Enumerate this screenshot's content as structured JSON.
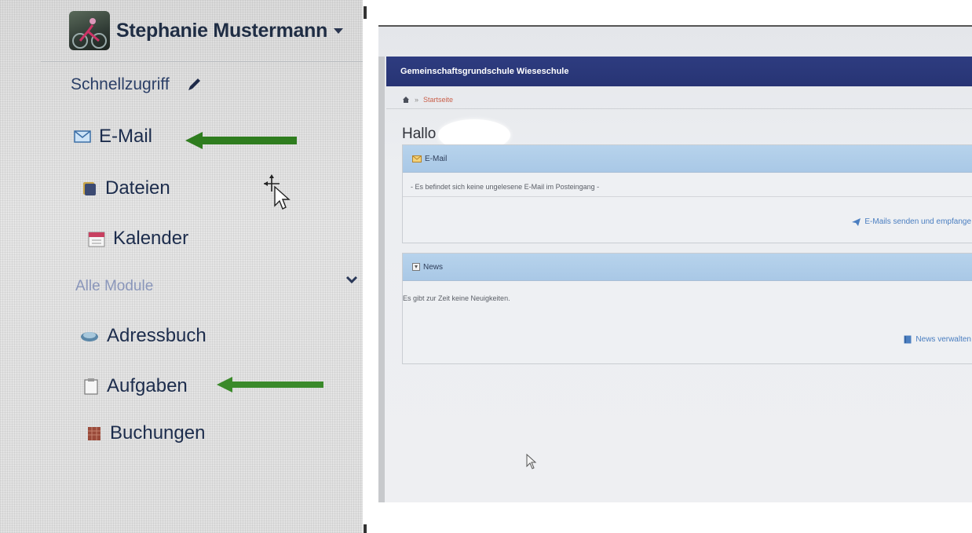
{
  "left": {
    "user": {
      "name": "Stephanie Mustermann"
    },
    "quick_access": {
      "label": "Schnellzugriff"
    },
    "nav": [
      {
        "label": "E-Mail",
        "icon": "envelope-icon"
      },
      {
        "label": "Dateien",
        "icon": "folder-icon"
      },
      {
        "label": "Kalender",
        "icon": "calendar-icon"
      }
    ],
    "modules": {
      "label": "Alle Module"
    },
    "module_items": [
      {
        "label": "Adressbuch",
        "icon": "address-book-icon"
      },
      {
        "label": "Aufgaben",
        "icon": "tasks-icon"
      },
      {
        "label": "Buchungen",
        "icon": "bookings-icon"
      }
    ]
  },
  "right": {
    "app_title": "Gemeinschaftsgrundschule Wieseschule",
    "breadcrumb": {
      "sep": "»",
      "current": "Startseite"
    },
    "greeting": "Hallo",
    "email_card": {
      "title": "E-Mail",
      "message": "- Es befindet sich keine ungelesene E-Mail im Posteingang -",
      "link": "E-Mails senden und empfange"
    },
    "news_card": {
      "title": "News",
      "message": "Es gibt zur Zeit keine Neuigkeiten.",
      "link": "News verwalten"
    }
  },
  "colors": {
    "header_blue": "#2b3779",
    "card_head_blue": "#b3cfea",
    "arrow_green": "#2f7d1f",
    "link_blue": "#4a7ec0",
    "breadcrumb_red": "#c95f4a"
  }
}
